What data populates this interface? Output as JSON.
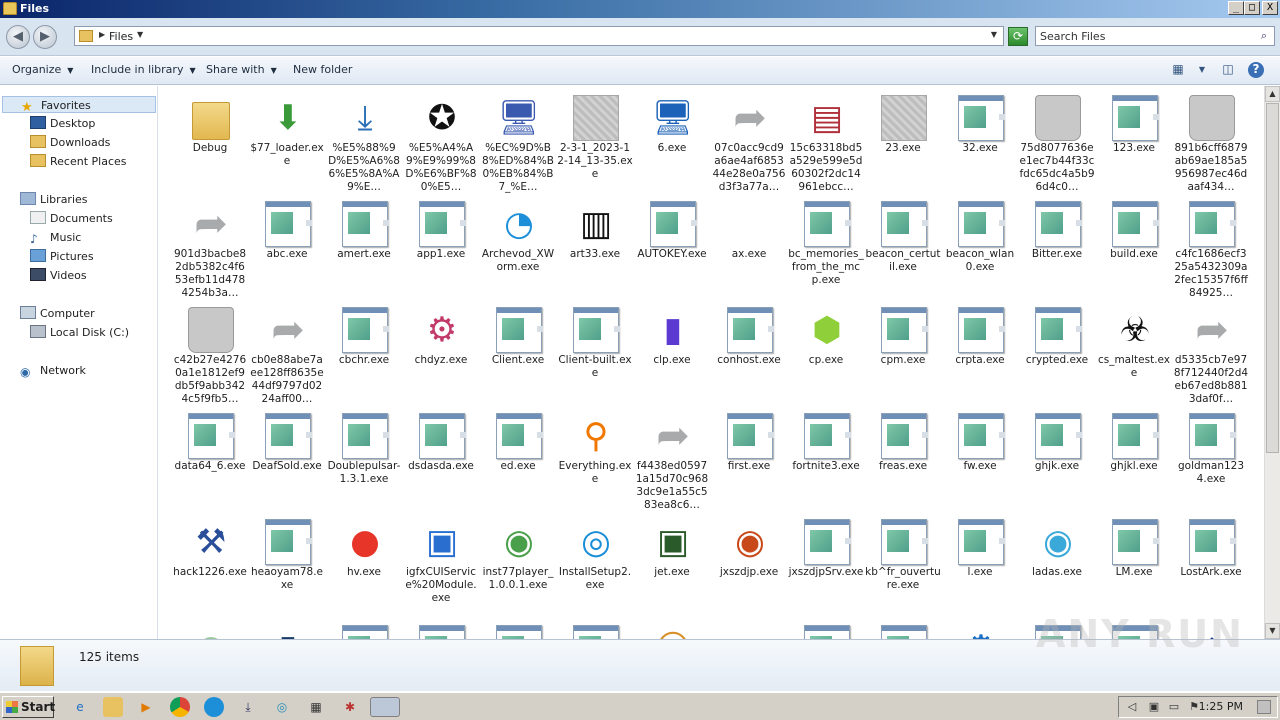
{
  "window": {
    "title": "Files",
    "minimize": "_",
    "maximize": "□",
    "close": "X"
  },
  "address": {
    "crumb": "Files",
    "search_placeholder": "Search Files"
  },
  "toolbar": {
    "organize": "Organize",
    "include_in_library": "Include in library",
    "share_with": "Share with",
    "new_folder": "New folder"
  },
  "nav": {
    "favorites": "Favorites",
    "desktop": "Desktop",
    "downloads": "Downloads",
    "recent_places": "Recent Places",
    "libraries": "Libraries",
    "documents": "Documents",
    "music": "Music",
    "pictures": "Pictures",
    "videos": "Videos",
    "computer": "Computer",
    "local_disk": "Local Disk (C:)",
    "network": "Network"
  },
  "files": [
    {
      "label": "Debug",
      "icon": "folder-icon"
    },
    {
      "label": "$77_loader.exe",
      "icon": "download-installer-icon"
    },
    {
      "label": "%E5%88%9D%E5%A6%86%E5%8A%A9%E…",
      "icon": "download-tray-icon"
    },
    {
      "label": "%E5%A4%A9%E9%99%8D%E6%BF%80%E5…",
      "icon": "sheriff-badge-icon"
    },
    {
      "label": "%EC%9D%B8%ED%84%B0%EB%84%B7_%E…",
      "icon": "globe-computer-icon"
    },
    {
      "label": "2-3-1_2023-12-14_13-35.exe",
      "icon": "blurred-icon"
    },
    {
      "label": "6.exe",
      "icon": "monitor-icon"
    },
    {
      "label": "07c0acc9cd9a6ae4af685344e28e0a756d3f3a77a…",
      "icon": "shortcut-arrow-icon"
    },
    {
      "label": "15c63318bd5a529e599e5d60302f2dc14961ebcc…",
      "icon": "winrar-icon"
    },
    {
      "label": "23.exe",
      "icon": "blurred-icon"
    },
    {
      "label": "32.exe",
      "icon": "app-window-icon"
    },
    {
      "label": "75d8077636ee1ec7b44f33cfdc65dc4a5b96d4c0…",
      "icon": "recycle-bin-icon"
    },
    {
      "label": "123.exe",
      "icon": "app-window-icon"
    },
    {
      "label": "891b6cff6879ab69ae185a5956987ec46daaf434…",
      "icon": "recycle-bin-icon"
    },
    {
      "label": "901d3bacbe82db5382c4f653efb11d4784254b3a…",
      "icon": "shortcut-arrow-icon"
    },
    {
      "label": "abc.exe",
      "icon": "app-window-icon"
    },
    {
      "label": "amert.exe",
      "icon": "app-window-icon"
    },
    {
      "label": "app1.exe",
      "icon": "app-window-icon"
    },
    {
      "label": "Archevod_XWorm.exe",
      "icon": "edge-icon"
    },
    {
      "label": "art33.exe",
      "icon": "barcode-icon"
    },
    {
      "label": "AUTOKEY.exe",
      "icon": "app-window-icon"
    },
    {
      "label": "ax.exe",
      "icon": "blank-icon"
    },
    {
      "label": "bc_memories_from_the_mcp.exe",
      "icon": "app-window-icon"
    },
    {
      "label": "beacon_certutil.exe",
      "icon": "app-window-icon"
    },
    {
      "label": "beacon_wlan0.exe",
      "icon": "app-window-icon"
    },
    {
      "label": "Bitter.exe",
      "icon": "app-window-icon"
    },
    {
      "label": "build.exe",
      "icon": "app-window-icon"
    },
    {
      "label": "c4fc1686ecf325a5432309a2fec15357f6ff84925…",
      "icon": "app-window-icon"
    },
    {
      "label": "c42b27e42760a1e1812ef9db5f9abb3424c5f9fb5…",
      "icon": "recycle-bin-icon"
    },
    {
      "label": "cb0e88abe7aee128ff8635e44df9797d0224aff00…",
      "icon": "shortcut-arrow-icon"
    },
    {
      "label": "cbchr.exe",
      "icon": "app-window-icon"
    },
    {
      "label": "chdyz.exe",
      "icon": "shield-gear-icon"
    },
    {
      "label": "Client.exe",
      "icon": "app-window-icon"
    },
    {
      "label": "Client-built.exe",
      "icon": "app-window-icon"
    },
    {
      "label": "clp.exe",
      "icon": "galaxy-icon"
    },
    {
      "label": "conhost.exe",
      "icon": "app-window-icon"
    },
    {
      "label": "cp.exe",
      "icon": "green-cube-icon"
    },
    {
      "label": "cpm.exe",
      "icon": "app-window-icon"
    },
    {
      "label": "crpta.exe",
      "icon": "app-window-icon"
    },
    {
      "label": "crypted.exe",
      "icon": "app-window-icon"
    },
    {
      "label": "cs_maltest.exe",
      "icon": "biohazard-icon"
    },
    {
      "label": "d5335cb7e978f712440f2d4eb67ed8b8813daf0f…",
      "icon": "shortcut-arrow-icon"
    },
    {
      "label": "data64_6.exe",
      "icon": "app-window-icon"
    },
    {
      "label": "DeafSold.exe",
      "icon": "app-window-icon"
    },
    {
      "label": "Doublepulsar-1.3.1.exe",
      "icon": "app-window-icon"
    },
    {
      "label": "dsdasda.exe",
      "icon": "app-window-icon"
    },
    {
      "label": "ed.exe",
      "icon": "app-window-icon"
    },
    {
      "label": "Everything.exe",
      "icon": "magnifier-icon"
    },
    {
      "label": "f4438ed05971a15d70c9683dc9e1a55c583ea8c6…",
      "icon": "shortcut-arrow-icon"
    },
    {
      "label": "first.exe",
      "icon": "app-window-icon"
    },
    {
      "label": "fortnite3.exe",
      "icon": "app-window-icon"
    },
    {
      "label": "freas.exe",
      "icon": "app-window-icon"
    },
    {
      "label": "fw.exe",
      "icon": "app-window-icon"
    },
    {
      "label": "ghjk.exe",
      "icon": "app-window-icon"
    },
    {
      "label": "ghjkl.exe",
      "icon": "app-window-icon"
    },
    {
      "label": "goldman1234.exe",
      "icon": "app-window-icon"
    },
    {
      "label": "hack1226.exe",
      "icon": "installer-icon"
    },
    {
      "label": "heaoyam78.exe",
      "icon": "app-window-icon"
    },
    {
      "label": "hv.exe",
      "icon": "red-player-icon"
    },
    {
      "label": "igfxCUIService%20Module.exe",
      "icon": "window-icon"
    },
    {
      "label": "inst77player_1.0.0.1.exe",
      "icon": "player-disc-icon"
    },
    {
      "label": "InstallSetup2.exe",
      "icon": "wifi-icon"
    },
    {
      "label": "jet.exe",
      "icon": "cmd-window-icon"
    },
    {
      "label": "jxszdjp.exe",
      "icon": "vortex-icon"
    },
    {
      "label": "jxszdjpSrv.exe",
      "icon": "app-window-icon"
    },
    {
      "label": "kb^fr_ouverture.exe",
      "icon": "app-window-icon"
    },
    {
      "label": "l.exe",
      "icon": "app-window-icon"
    },
    {
      "label": "ladas.exe",
      "icon": "eye-icon"
    },
    {
      "label": "LM.exe",
      "icon": "app-window-icon"
    },
    {
      "label": "LostArk.exe",
      "icon": "app-window-icon"
    },
    {
      "label": "",
      "icon": "green-sphere-icon"
    },
    {
      "label": "",
      "icon": "server-icon"
    },
    {
      "label": "",
      "icon": "app-window-icon"
    },
    {
      "label": "",
      "icon": "app-window-icon"
    },
    {
      "label": "",
      "icon": "app-window-icon"
    },
    {
      "label": "",
      "icon": "app-window-icon"
    },
    {
      "label": "",
      "icon": "user-icon"
    },
    {
      "label": "",
      "icon": "wing-icon"
    },
    {
      "label": "",
      "icon": "app-window-icon"
    },
    {
      "label": "",
      "icon": "app-window-icon"
    },
    {
      "label": "",
      "icon": "settings-window-icon"
    },
    {
      "label": "",
      "icon": "app-window-icon"
    },
    {
      "label": "",
      "icon": "app-window-icon"
    },
    {
      "label": "",
      "icon": "cube-icon"
    }
  ],
  "status": {
    "count": "125 items"
  },
  "watermark": "ANY RUN",
  "taskbar": {
    "start": "Start",
    "clock": "1:25 PM"
  }
}
